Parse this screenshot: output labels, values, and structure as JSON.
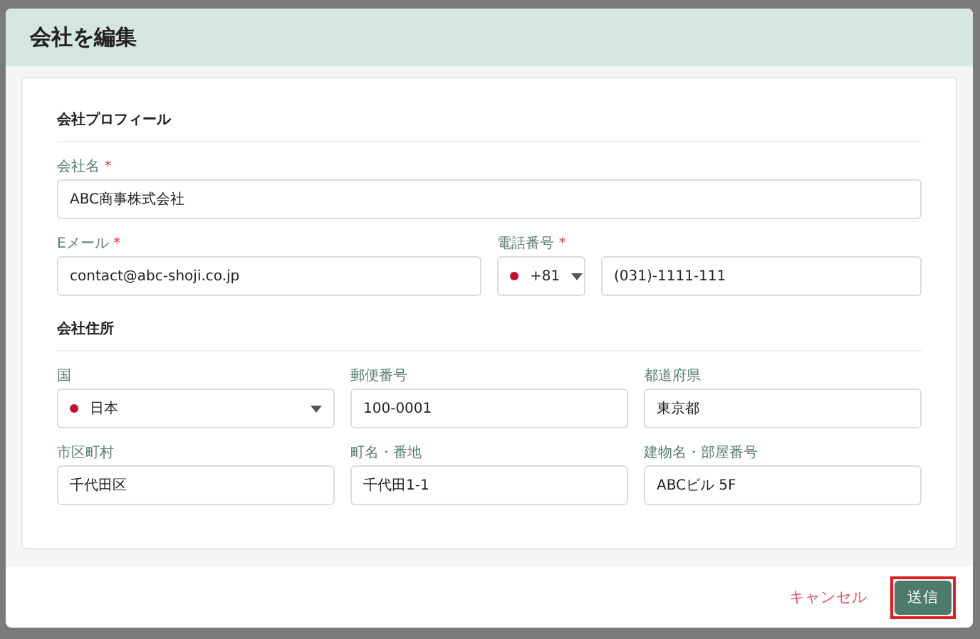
{
  "dialog": {
    "title": "会社を編集"
  },
  "sections": [
    {
      "title": "会社プロフィール",
      "rows": [
        [
          {
            "kind": "text",
            "label": "会社名",
            "mark": "*",
            "value": "ABC商事株式会社"
          }
        ],
        [
          {
            "kind": "text",
            "label": "Eメール",
            "mark": "*",
            "value": "contact@abc-shoji.co.jp"
          },
          {
            "kind": "phone",
            "label": "電話番号",
            "mark": "*",
            "code": "+81",
            "value": "(031)-1111-111"
          }
        ]
      ]
    },
    {
      "title": "会社住所",
      "rows": [
        [
          {
            "kind": "select",
            "label": "国",
            "value": "日本"
          },
          {
            "kind": "text",
            "label": "郵便番号",
            "value": "100-0001"
          },
          {
            "kind": "text",
            "label": "都道府県",
            "value": "東京都"
          }
        ],
        [
          {
            "kind": "text",
            "label": "市区町村",
            "value": "千代田区"
          },
          {
            "kind": "text",
            "label": "町名・番地",
            "value": "千代田1-1"
          },
          {
            "kind": "text",
            "label": "建物名・部屋番号",
            "value": "ABCビル 5F"
          }
        ]
      ]
    }
  ],
  "footer": {
    "cancel": "キャンセル",
    "submit": {
      "label": "送信",
      "highlighted": true
    }
  }
}
